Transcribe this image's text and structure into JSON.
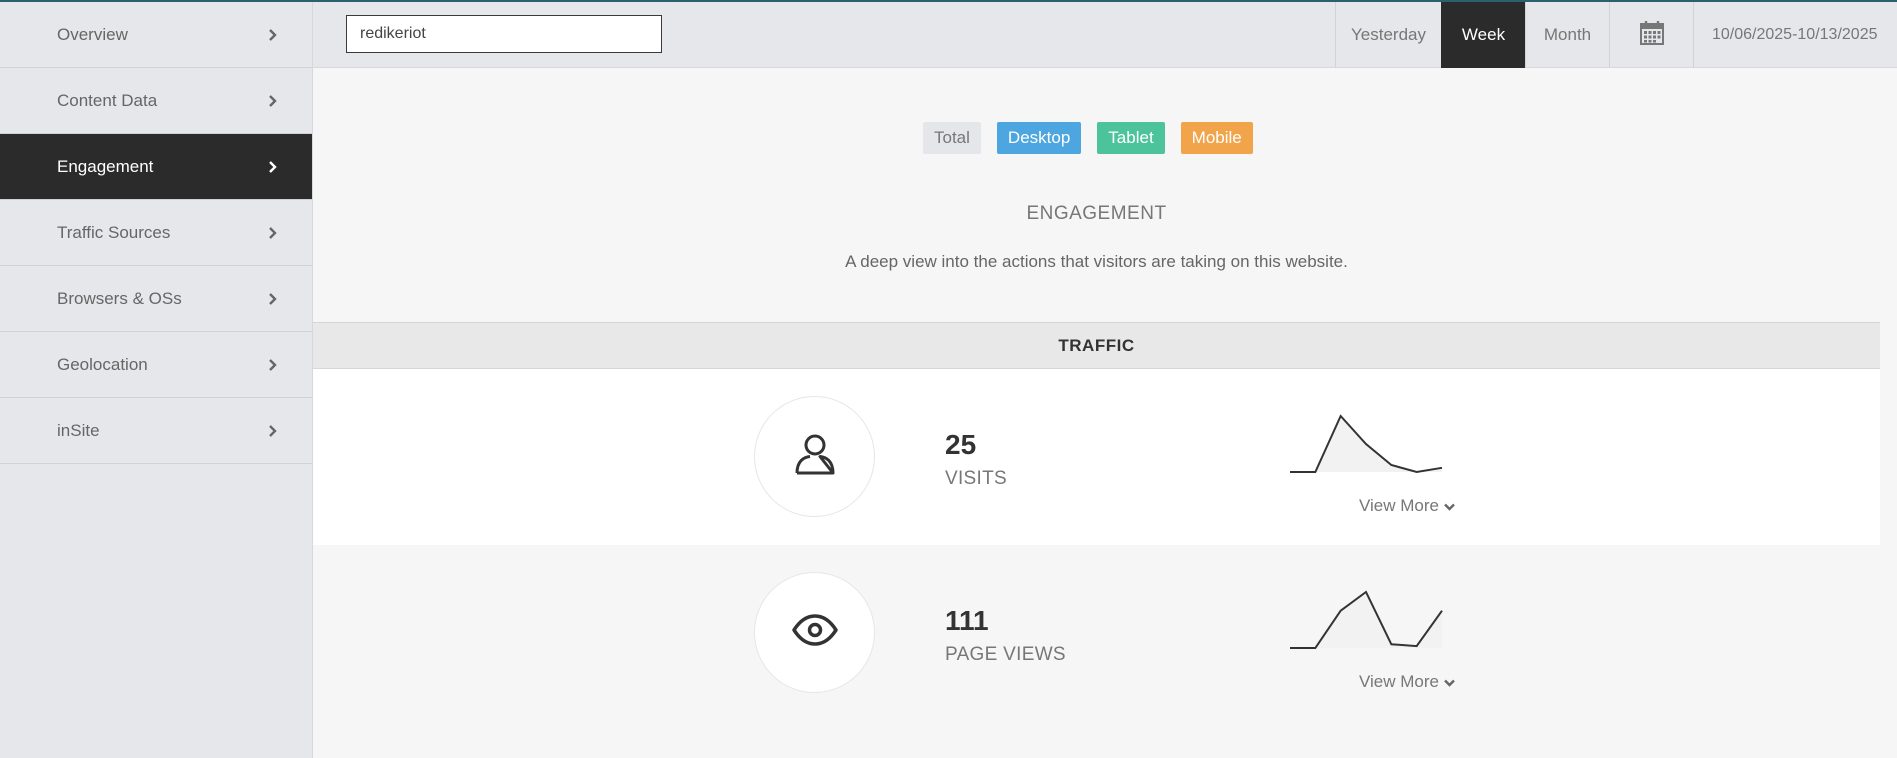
{
  "sidebar": {
    "items": [
      {
        "label": "Overview"
      },
      {
        "label": "Content Data"
      },
      {
        "label": "Engagement",
        "active": true
      },
      {
        "label": "Traffic Sources"
      },
      {
        "label": "Browsers & OSs"
      },
      {
        "label": "Geolocation"
      },
      {
        "label": "inSite"
      }
    ]
  },
  "topbar": {
    "search_value": "redikeriot",
    "ranges": [
      "Yesterday",
      "Week",
      "Month"
    ],
    "active_range": "Week",
    "calendar_icon": "calendar-icon",
    "date_range": "10/06/2025-10/13/2025"
  },
  "filters": [
    "Total",
    "Desktop",
    "Tablet",
    "Mobile"
  ],
  "colors": {
    "desktop": "#4da6df",
    "tablet": "#4cc39a",
    "mobile": "#f2a44b",
    "active_dark": "#2b2b2b"
  },
  "main": {
    "title": "ENGAGEMENT",
    "description": "A deep view into the actions that visitors are taking on this website.",
    "section": "TRAFFIC"
  },
  "metrics": [
    {
      "value": "25",
      "label": "VISITS",
      "icon": "user-icon",
      "view_more": "View More",
      "trend": [
        0,
        0,
        8,
        4,
        1,
        0,
        0.6
      ]
    },
    {
      "value": "111",
      "label": "PAGE VIEWS",
      "icon": "eye-icon",
      "view_more": "View More",
      "trend": [
        0,
        0,
        4,
        6,
        0.4,
        0.2,
        4
      ]
    }
  ]
}
